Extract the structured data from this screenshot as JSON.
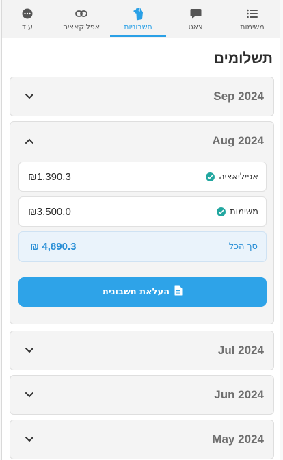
{
  "colors": {
    "accent": "#2aa0e6",
    "check": "#22a7a0",
    "button": "#2ea3e8"
  },
  "nav": {
    "tasks": {
      "label": "משימות",
      "icon": "list-icon"
    },
    "chat": {
      "label": "צאט",
      "icon": "chat-icon"
    },
    "invoices": {
      "label": "חשבוניות",
      "icon": "invoice-icon",
      "active": true
    },
    "apps": {
      "label": "אפליקאציה",
      "icon": "link-icon"
    },
    "more": {
      "label": "עוד",
      "icon": "more-icon"
    }
  },
  "page": {
    "title": "תשלומים"
  },
  "months": {
    "sep": {
      "label": "Sep 2024",
      "expanded": false
    },
    "aug": {
      "label": "Aug 2024",
      "expanded": true,
      "rows": [
        {
          "label": "אפיליאציה",
          "amount": "₪1,390.3"
        },
        {
          "label": "משימות",
          "amount": "₪3,500.0"
        }
      ],
      "total_label": "סך הכל",
      "total_amount": "₪ 4,890.3",
      "upload_label": "העלאת חשבונית"
    },
    "jul": {
      "label": "Jul 2024",
      "expanded": false
    },
    "jun": {
      "label": "Jun 2024",
      "expanded": false
    },
    "may": {
      "label": "May 2024",
      "expanded": false
    }
  }
}
